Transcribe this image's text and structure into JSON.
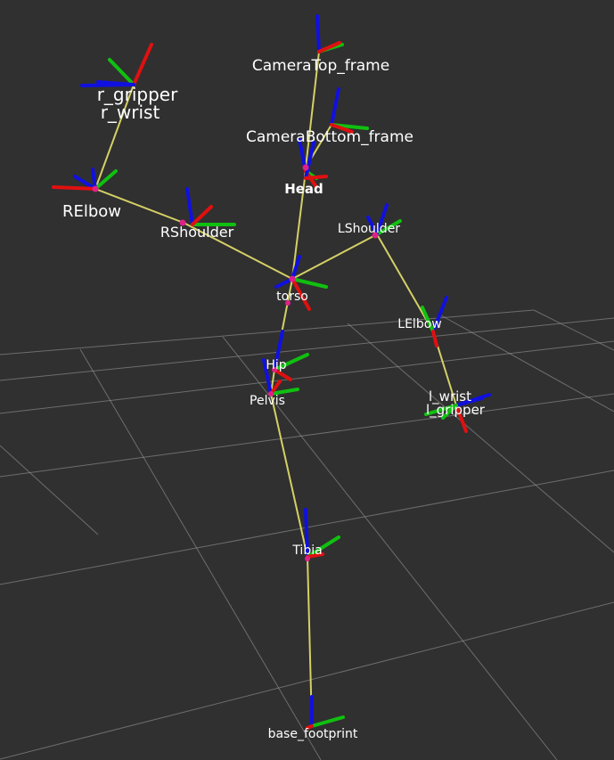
{
  "view": {
    "title": "",
    "background": "#303030",
    "grid_color": "#a0a0a0",
    "link_color": "#d4d066",
    "axis_colors": {
      "x": "#e01010",
      "y": "#10c010",
      "z": "#1010e0"
    },
    "origin_marker_color": "#e0208a"
  },
  "frames": {
    "camera_top": "CameraTop_frame",
    "camera_bottom": "CameraBottom_frame",
    "head": "Head",
    "r_gripper": "r_gripper",
    "r_wrist": "r_wrist",
    "r_elbow": "RElbow",
    "r_shoulder": "RShoulder",
    "l_shoulder": "LShoulder",
    "torso": "torso",
    "l_elbow": "LElbow",
    "hip": "Hip",
    "pelvis": "Pelvis",
    "l_wrist": "l_wrist",
    "l_gripper": "l_gripper",
    "tibia": "Tibia",
    "base_footprint": "base_footprint"
  }
}
